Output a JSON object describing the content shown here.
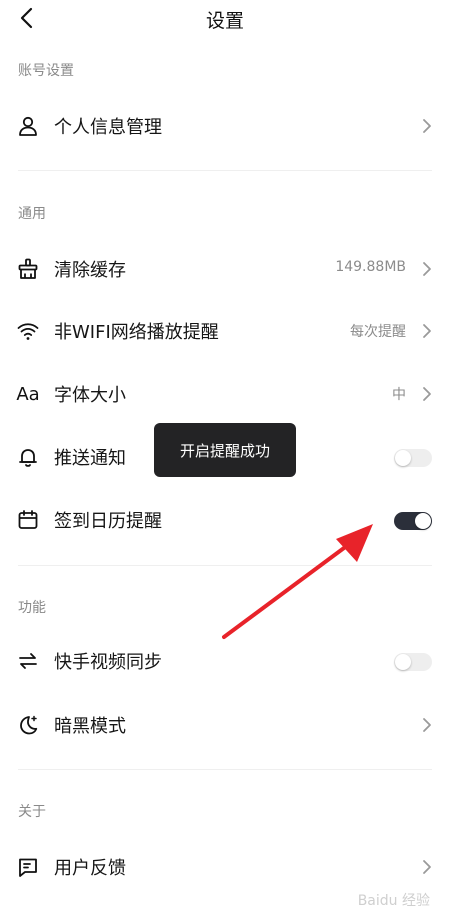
{
  "header": {
    "title": "设置"
  },
  "sections": {
    "account": {
      "title": "账号设置"
    },
    "general": {
      "title": "通用"
    },
    "features": {
      "title": "功能"
    },
    "about": {
      "title": "关于"
    }
  },
  "rows": {
    "profile": {
      "label": "个人信息管理"
    },
    "cache": {
      "label": "清除缓存",
      "value": "149.88MB"
    },
    "nonwifi": {
      "label": "非WIFI网络播放提醒",
      "value": "每次提醒"
    },
    "fontsize": {
      "label": "字体大小",
      "value": "中",
      "icon_text": "Aa"
    },
    "push": {
      "label": "推送通知",
      "enabled": false
    },
    "checkin": {
      "label": "签到日历提醒",
      "enabled": true
    },
    "sync": {
      "label": "快手视频同步",
      "enabled": false
    },
    "dark": {
      "label": "暗黑模式"
    },
    "feedback": {
      "label": "用户反馈"
    }
  },
  "toast": {
    "text": "开启提醒成功"
  },
  "watermark": {
    "text": "Baidu 经验"
  },
  "colors": {
    "toggle_on": "#2b2f3a",
    "toggle_off": "#eeeeee",
    "arrow": "#e8232a"
  }
}
